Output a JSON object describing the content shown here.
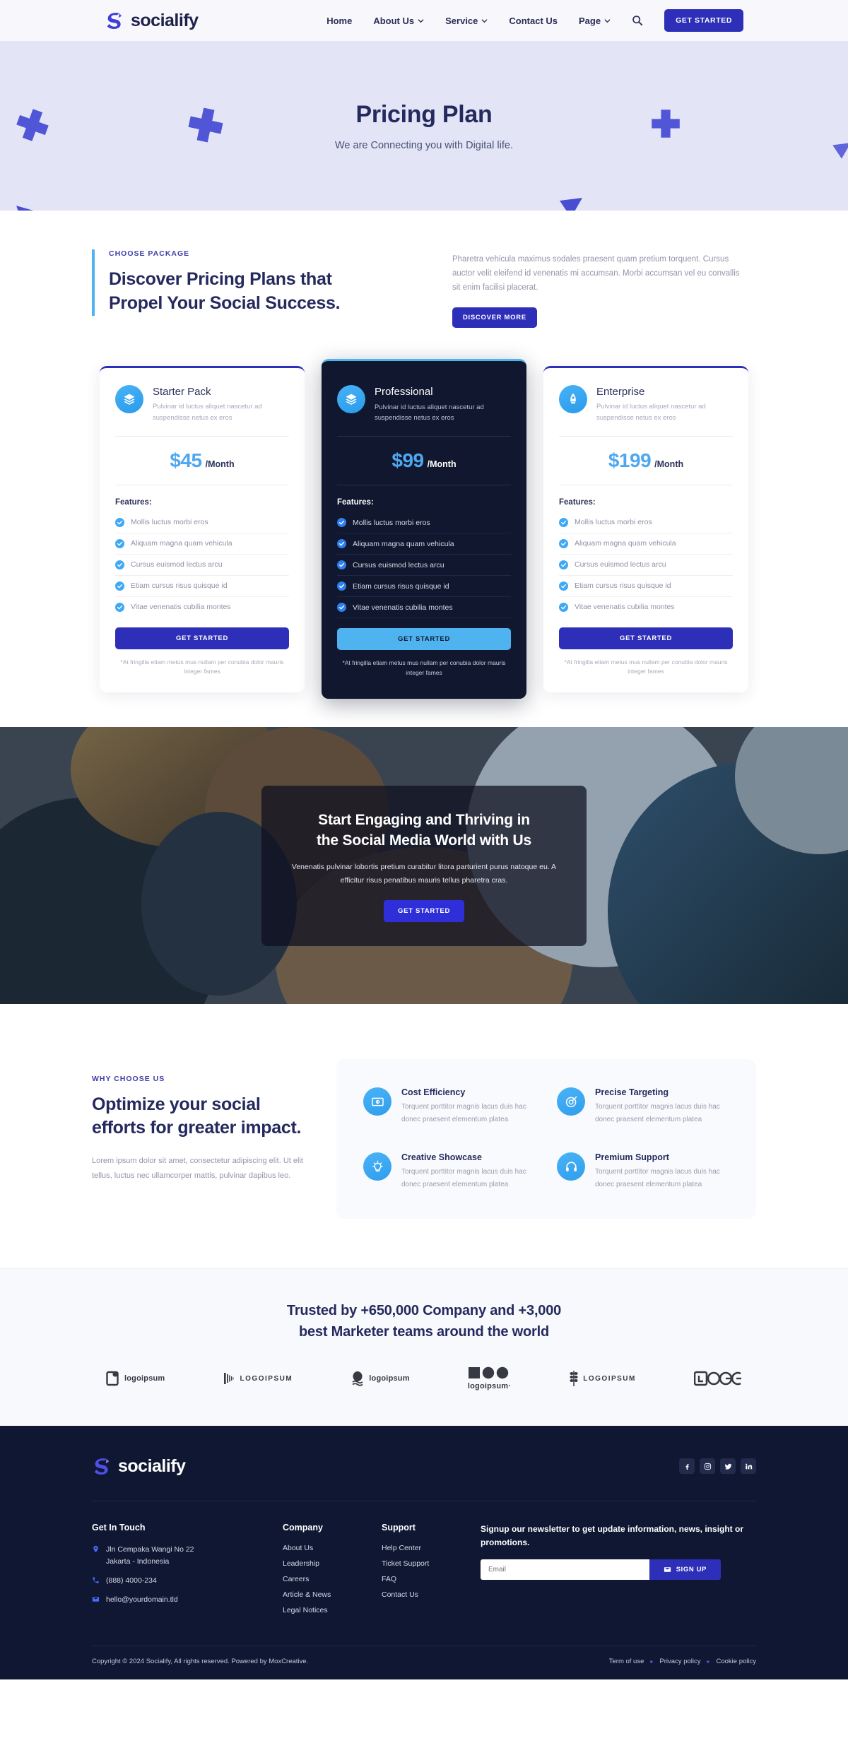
{
  "navbar": {
    "brand": "socialify",
    "links": [
      {
        "label": "Home",
        "caret": false
      },
      {
        "label": "About Us",
        "caret": true
      },
      {
        "label": "Service",
        "caret": true
      },
      {
        "label": "Contact Us",
        "caret": false
      },
      {
        "label": "Page",
        "caret": true
      }
    ],
    "search_icon": "search-icon",
    "cta": "GET STARTED"
  },
  "hero": {
    "title": "Pricing Plan",
    "subtitle": "We are Connecting you with Digital life."
  },
  "pricing_intro": {
    "eyebrow": "CHOOSE PACKAGE",
    "heading_line1": "Discover Pricing Plans that",
    "heading_line2": "Propel Your Social Success.",
    "body": "Pharetra vehicula maximus sodales praesent quam pretium torquent. Cursus auctor velit eleifend id venenatis mi accumsan. Morbi accumsan vel eu convallis sit enim facilisi placerat.",
    "button": "DISCOVER MORE"
  },
  "plans": [
    {
      "name": "Starter Pack",
      "icon": "layers-icon",
      "desc": "Pulvinar id luctus aliquet nascetur ad suspendisse netus ex eros",
      "price": "$45",
      "period": "/Month",
      "features_label": "Features:",
      "features": [
        "Mollis luctus morbi eros",
        "Aliquam magna quam vehicula",
        "Cursus euismod lectus arcu",
        "Etiam cursus risus quisque id",
        "Vitae venenatis cubilia montes"
      ],
      "button": "GET STARTED",
      "note": "*At fringilla etiam metus mus nullam per conubia dolor mauris integer fames",
      "featured": false
    },
    {
      "name": "Professional",
      "icon": "layers-stack-icon",
      "desc": "Pulvinar id luctus aliquet nascetur ad suspendisse netus ex eros",
      "price": "$99",
      "period": "/Month",
      "features_label": "Features:",
      "features": [
        "Mollis luctus morbi eros",
        "Aliquam magna quam vehicula",
        "Cursus euismod lectus arcu",
        "Etiam cursus risus quisque id",
        "Vitae venenatis cubilia montes"
      ],
      "button": "GET STARTED",
      "note": "*At fringilla etiam metus mus nullam per conubia dolor mauris integer fames",
      "featured": true
    },
    {
      "name": "Enterprise",
      "icon": "rocket-icon",
      "desc": "Pulvinar id luctus aliquet nascetur ad suspendisse netus ex eros",
      "price": "$199",
      "period": "/Month",
      "features_label": "Features:",
      "features": [
        "Mollis luctus morbi eros",
        "Aliquam magna quam vehicula",
        "Cursus euismod lectus arcu",
        "Etiam cursus risus quisque id",
        "Vitae venenatis cubilia montes"
      ],
      "button": "GET STARTED",
      "note": "*At fringilla etiam metus mus nullam per conubia dolor mauris integer fames",
      "featured": false
    }
  ],
  "cta_banner": {
    "heading_line1": "Start Engaging and Thriving in",
    "heading_line2": "the Social Media World with Us",
    "body": "Venenatis pulvinar lobortis pretium curabitur litora parturient purus natoque eu. A efficitur risus penatibus mauris tellus pharetra cras.",
    "button": "GET STARTED"
  },
  "why": {
    "eyebrow": "WHY CHOOSE US",
    "heading": "Optimize your social efforts for greater impact.",
    "body": "Lorem ipsum dolor sit amet, consectetur adipiscing elit. Ut elit tellus, luctus nec ullamcorper mattis, pulvinar dapibus leo.",
    "features": [
      {
        "title": "Cost Efficiency",
        "icon": "money-icon",
        "desc": "Torquent porttitor magnis lacus duis hac donec praesent elementum platea"
      },
      {
        "title": "Precise Targeting",
        "icon": "target-icon",
        "desc": "Torquent porttitor magnis lacus duis hac donec praesent elementum platea"
      },
      {
        "title": "Creative Showcase",
        "icon": "lightbulb-icon",
        "desc": "Torquent porttitor magnis lacus duis hac donec praesent elementum platea"
      },
      {
        "title": "Premium Support",
        "icon": "headset-icon",
        "desc": "Torquent porttitor magnis lacus duis hac donec praesent elementum platea"
      }
    ]
  },
  "trusted": {
    "heading_line1": "Trusted by +650,000 Company and +3,000",
    "heading_line2": "best Marketer teams around the world",
    "logos": [
      {
        "text": "logoipsum",
        "style": "bold",
        "mark": "square-pin"
      },
      {
        "text": "LOGOIPSUM",
        "style": "spaced",
        "mark": "bars"
      },
      {
        "text": "logoipsum",
        "style": "bold",
        "mark": "egg"
      },
      {
        "text": "logoipsum·",
        "style": "bold",
        "mark": "dots-top"
      },
      {
        "text": "LOGOIPSUM",
        "style": "spaced",
        "mark": "wheat"
      },
      {
        "text": "LOGO",
        "style": "bold",
        "mark": "blocks"
      }
    ]
  },
  "footer": {
    "brand": "socialify",
    "socials": [
      "facebook-icon",
      "instagram-icon",
      "twitter-icon",
      "linkedin-icon"
    ],
    "contact": {
      "title": "Get In Touch",
      "address_line1": "Jln Cempaka Wangi No 22",
      "address_line2": "Jakarta - Indonesia",
      "phone": "(888) 4000-234",
      "email": "hello@yourdomain.tld"
    },
    "company": {
      "title": "Company",
      "links": [
        "About Us",
        "Leadership",
        "Careers",
        "Article & News",
        "Legal Notices"
      ]
    },
    "support": {
      "title": "Support",
      "links": [
        "Help Center",
        "Ticket Support",
        "FAQ",
        "Contact Us"
      ]
    },
    "newsletter": {
      "title": "Signup our newsletter to get update information, news, insight or promotions.",
      "placeholder": "Email",
      "value": "",
      "button": "SIGN UP"
    },
    "copyright": "Copyright © 2024 Socialify, All rights reserved. Powered by MoxCreative.",
    "legal": [
      "Term of use",
      "Privacy policy",
      "Cookie policy"
    ]
  },
  "colors": {
    "brand_primary": "#2e2fb8",
    "accent_blue": "#4fb3f0",
    "dark_navy": "#101733",
    "hero_bg": "#e3e5f7"
  }
}
